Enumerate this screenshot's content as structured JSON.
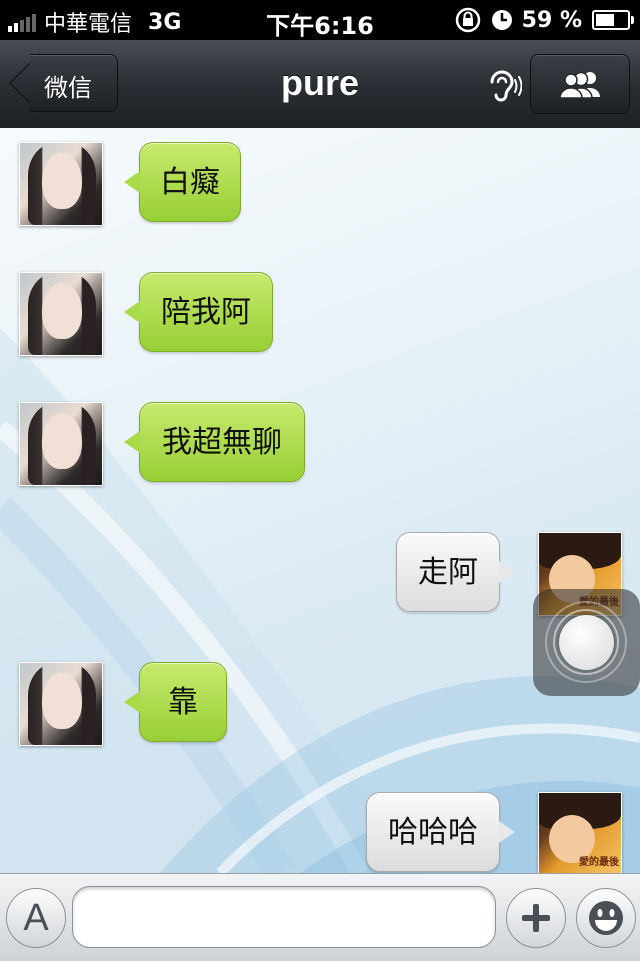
{
  "status_bar": {
    "carrier": "中華電信",
    "network": "3G",
    "time": "下午6:16",
    "battery_percent_label": "59 %",
    "battery_level": 0.59,
    "icons": [
      "signal-icon",
      "rotation-lock-icon",
      "clock-icon",
      "battery-icon"
    ]
  },
  "nav": {
    "back_label": "微信",
    "title": "pure",
    "icons": [
      "ear-icon",
      "group-icon"
    ]
  },
  "messages": [
    {
      "side": "left",
      "text": "白癡",
      "color": "green"
    },
    {
      "side": "left",
      "text": "陪我阿",
      "color": "green"
    },
    {
      "side": "left",
      "text": "我超無聊",
      "color": "green"
    },
    {
      "side": "right",
      "text": "走阿",
      "color": "gray"
    },
    {
      "side": "left",
      "text": "靠",
      "color": "green"
    },
    {
      "side": "right",
      "text": "哈哈哈",
      "color": "gray"
    }
  ],
  "avatar_caption": "愛的最後",
  "input_bar": {
    "keyboard_icon_label": "A",
    "text_value": "",
    "icons": [
      "keyboard-toggle-icon",
      "plus-icon",
      "emoji-icon"
    ]
  },
  "colors": {
    "green_bubble": "#a9db48",
    "gray_bubble": "#e8e8e8",
    "navbar": "#2b2f34"
  }
}
